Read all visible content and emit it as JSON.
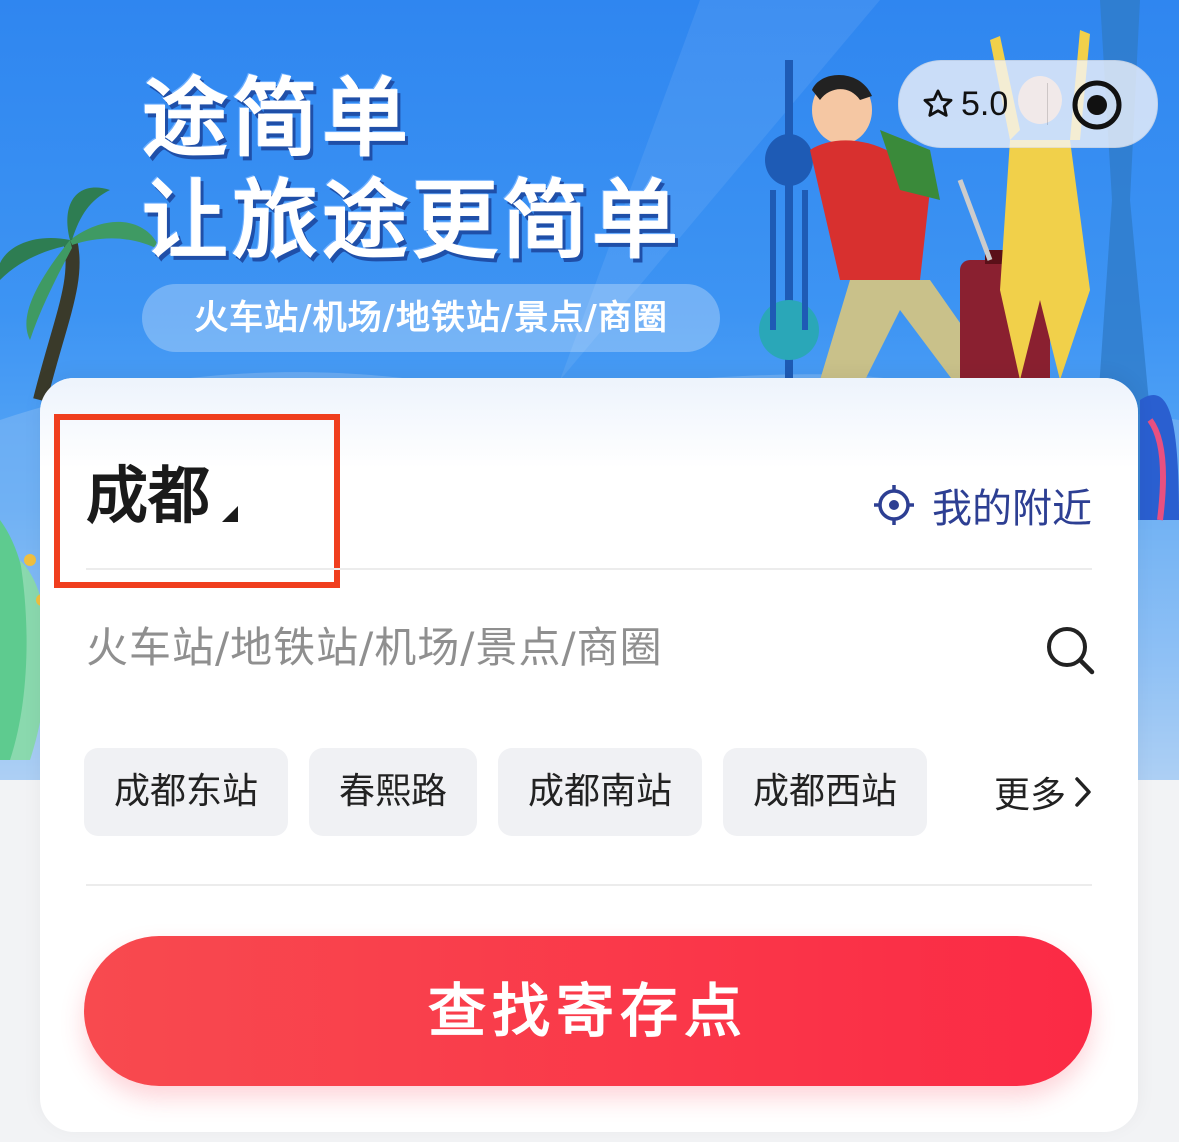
{
  "banner": {
    "slogan_line1": "途简单",
    "slogan_line2": "让旅途更简单",
    "tags": "火车站/机场/地铁站/景点/商圈"
  },
  "capsule": {
    "rating": "5.0",
    "rating_icon": "star-outline-icon",
    "action_icon": "target-dot-icon"
  },
  "search_card": {
    "city": "成都",
    "nearby_label": "我的附近",
    "search_placeholder": "火车站/地铁站/机场/景点/商圈",
    "quick_tags": [
      "成都东站",
      "春熙路",
      "成都南站",
      "成都西站"
    ],
    "more_label": "更多",
    "submit_label": "查找寄存点"
  },
  "colors": {
    "brand_blue": "#2f86f0",
    "primary_red": "#fb2a45",
    "nearby_blue": "#2d3f93",
    "highlight_box": "#f03e1e"
  }
}
